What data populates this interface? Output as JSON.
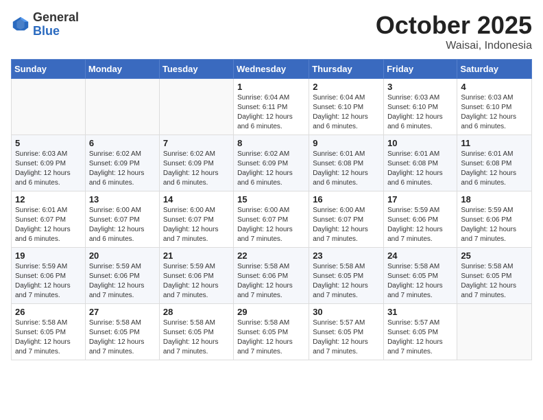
{
  "header": {
    "logo_general": "General",
    "logo_blue": "Blue",
    "month": "October 2025",
    "location": "Waisai, Indonesia"
  },
  "weekdays": [
    "Sunday",
    "Monday",
    "Tuesday",
    "Wednesday",
    "Thursday",
    "Friday",
    "Saturday"
  ],
  "weeks": [
    [
      {
        "day": "",
        "info": ""
      },
      {
        "day": "",
        "info": ""
      },
      {
        "day": "",
        "info": ""
      },
      {
        "day": "1",
        "info": "Sunrise: 6:04 AM\nSunset: 6:11 PM\nDaylight: 12 hours\nand 6 minutes."
      },
      {
        "day": "2",
        "info": "Sunrise: 6:04 AM\nSunset: 6:10 PM\nDaylight: 12 hours\nand 6 minutes."
      },
      {
        "day": "3",
        "info": "Sunrise: 6:03 AM\nSunset: 6:10 PM\nDaylight: 12 hours\nand 6 minutes."
      },
      {
        "day": "4",
        "info": "Sunrise: 6:03 AM\nSunset: 6:10 PM\nDaylight: 12 hours\nand 6 minutes."
      }
    ],
    [
      {
        "day": "5",
        "info": "Sunrise: 6:03 AM\nSunset: 6:09 PM\nDaylight: 12 hours\nand 6 minutes."
      },
      {
        "day": "6",
        "info": "Sunrise: 6:02 AM\nSunset: 6:09 PM\nDaylight: 12 hours\nand 6 minutes."
      },
      {
        "day": "7",
        "info": "Sunrise: 6:02 AM\nSunset: 6:09 PM\nDaylight: 12 hours\nand 6 minutes."
      },
      {
        "day": "8",
        "info": "Sunrise: 6:02 AM\nSunset: 6:09 PM\nDaylight: 12 hours\nand 6 minutes."
      },
      {
        "day": "9",
        "info": "Sunrise: 6:01 AM\nSunset: 6:08 PM\nDaylight: 12 hours\nand 6 minutes."
      },
      {
        "day": "10",
        "info": "Sunrise: 6:01 AM\nSunset: 6:08 PM\nDaylight: 12 hours\nand 6 minutes."
      },
      {
        "day": "11",
        "info": "Sunrise: 6:01 AM\nSunset: 6:08 PM\nDaylight: 12 hours\nand 6 minutes."
      }
    ],
    [
      {
        "day": "12",
        "info": "Sunrise: 6:01 AM\nSunset: 6:07 PM\nDaylight: 12 hours\nand 6 minutes."
      },
      {
        "day": "13",
        "info": "Sunrise: 6:00 AM\nSunset: 6:07 PM\nDaylight: 12 hours\nand 6 minutes."
      },
      {
        "day": "14",
        "info": "Sunrise: 6:00 AM\nSunset: 6:07 PM\nDaylight: 12 hours\nand 7 minutes."
      },
      {
        "day": "15",
        "info": "Sunrise: 6:00 AM\nSunset: 6:07 PM\nDaylight: 12 hours\nand 7 minutes."
      },
      {
        "day": "16",
        "info": "Sunrise: 6:00 AM\nSunset: 6:07 PM\nDaylight: 12 hours\nand 7 minutes."
      },
      {
        "day": "17",
        "info": "Sunrise: 5:59 AM\nSunset: 6:06 PM\nDaylight: 12 hours\nand 7 minutes."
      },
      {
        "day": "18",
        "info": "Sunrise: 5:59 AM\nSunset: 6:06 PM\nDaylight: 12 hours\nand 7 minutes."
      }
    ],
    [
      {
        "day": "19",
        "info": "Sunrise: 5:59 AM\nSunset: 6:06 PM\nDaylight: 12 hours\nand 7 minutes."
      },
      {
        "day": "20",
        "info": "Sunrise: 5:59 AM\nSunset: 6:06 PM\nDaylight: 12 hours\nand 7 minutes."
      },
      {
        "day": "21",
        "info": "Sunrise: 5:59 AM\nSunset: 6:06 PM\nDaylight: 12 hours\nand 7 minutes."
      },
      {
        "day": "22",
        "info": "Sunrise: 5:58 AM\nSunset: 6:06 PM\nDaylight: 12 hours\nand 7 minutes."
      },
      {
        "day": "23",
        "info": "Sunrise: 5:58 AM\nSunset: 6:05 PM\nDaylight: 12 hours\nand 7 minutes."
      },
      {
        "day": "24",
        "info": "Sunrise: 5:58 AM\nSunset: 6:05 PM\nDaylight: 12 hours\nand 7 minutes."
      },
      {
        "day": "25",
        "info": "Sunrise: 5:58 AM\nSunset: 6:05 PM\nDaylight: 12 hours\nand 7 minutes."
      }
    ],
    [
      {
        "day": "26",
        "info": "Sunrise: 5:58 AM\nSunset: 6:05 PM\nDaylight: 12 hours\nand 7 minutes."
      },
      {
        "day": "27",
        "info": "Sunrise: 5:58 AM\nSunset: 6:05 PM\nDaylight: 12 hours\nand 7 minutes."
      },
      {
        "day": "28",
        "info": "Sunrise: 5:58 AM\nSunset: 6:05 PM\nDaylight: 12 hours\nand 7 minutes."
      },
      {
        "day": "29",
        "info": "Sunrise: 5:58 AM\nSunset: 6:05 PM\nDaylight: 12 hours\nand 7 minutes."
      },
      {
        "day": "30",
        "info": "Sunrise: 5:57 AM\nSunset: 6:05 PM\nDaylight: 12 hours\nand 7 minutes."
      },
      {
        "day": "31",
        "info": "Sunrise: 5:57 AM\nSunset: 6:05 PM\nDaylight: 12 hours\nand 7 minutes."
      },
      {
        "day": "",
        "info": ""
      }
    ]
  ]
}
